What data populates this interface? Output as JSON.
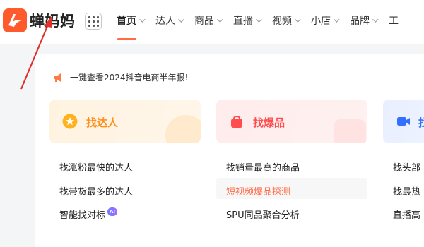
{
  "logo": {
    "text": "蝉妈妈"
  },
  "nav": {
    "items": [
      {
        "label": "首页",
        "active": true,
        "caret": true
      },
      {
        "label": "达人",
        "active": false,
        "caret": true
      },
      {
        "label": "商品",
        "active": false,
        "caret": true
      },
      {
        "label": "直播",
        "active": false,
        "caret": true
      },
      {
        "label": "视频",
        "active": false,
        "caret": true
      },
      {
        "label": "小店",
        "active": false,
        "caret": true
      },
      {
        "label": "品牌",
        "active": false,
        "caret": true
      },
      {
        "label": "工",
        "active": false,
        "caret": false
      }
    ],
    "accent": "#ff6b45"
  },
  "announcement": {
    "icon": "megaphone-icon",
    "text": "一键查看2024抖音电商半年报!"
  },
  "cards": [
    {
      "title": "找达人",
      "icon": "star-badge-icon",
      "color": "#ff8f1f",
      "links": [
        "找涨粉最快的达人",
        "找带货最多的达人",
        "智能找对标"
      ]
    },
    {
      "title": "找爆品",
      "icon": "shopping-bag-icon",
      "color": "#ff4d4f",
      "links": [
        "找销量最高的商品",
        "短视频爆品探测",
        "SPU同品聚合分析"
      ]
    },
    {
      "title": "找",
      "icon": "video-camera-icon",
      "color": "#3370ff",
      "links": [
        "找头部",
        "找最热",
        "直播高"
      ]
    }
  ],
  "ai_badge": "AI"
}
